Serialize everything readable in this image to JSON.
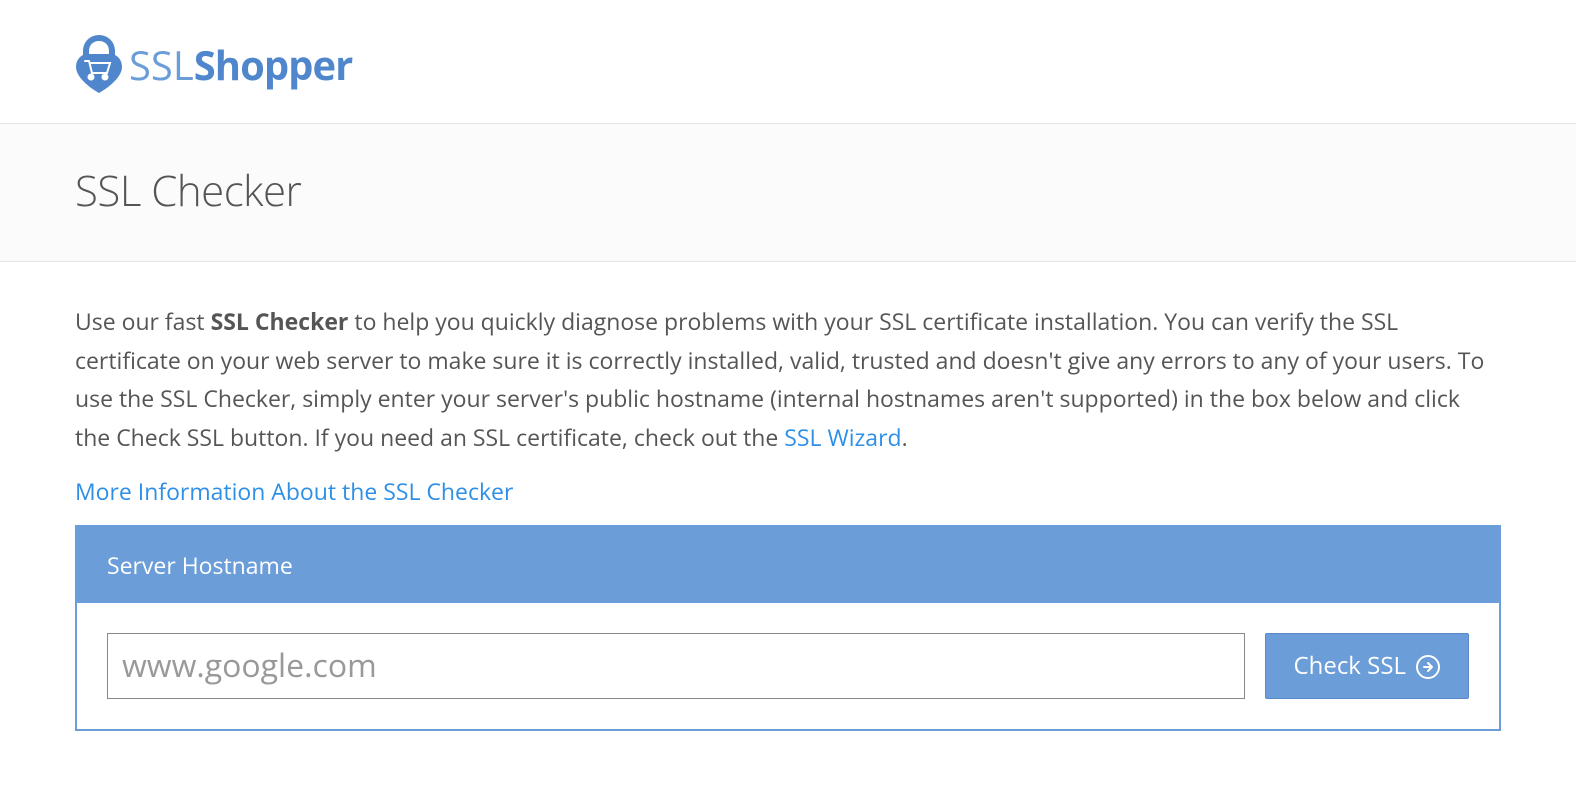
{
  "brand": {
    "part1": "SSL",
    "part2": "Shopper"
  },
  "page": {
    "title": "SSL Checker"
  },
  "description": {
    "prefix": "Use our fast ",
    "bold": "SSL Checker",
    "body": " to help you quickly diagnose problems with your SSL certificate installation. You can verify the SSL certificate on your web server to make sure it is correctly installed, valid, trusted and doesn't give any errors to any of your users. To use the SSL Checker, simply enter your server's public hostname (internal hostnames aren't supported) in the box below and click the Check SSL button. If you need an SSL certificate, check out the ",
    "link_text": "SSL Wizard",
    "suffix": "."
  },
  "more_info_link": "More Information About the SSL Checker",
  "form": {
    "header": "Server Hostname",
    "input_placeholder": "www.google.com",
    "input_value": "",
    "button_label": "Check SSL"
  }
}
